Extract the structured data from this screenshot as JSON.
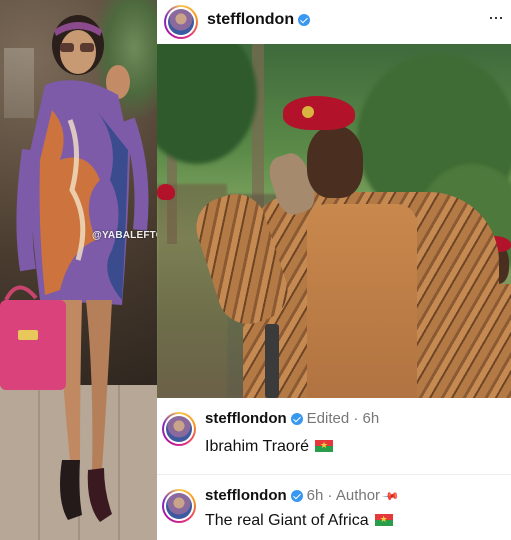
{
  "post": {
    "author": "stefflondon",
    "watermark": "@YABALEFTONLINE"
  },
  "header": {
    "username": "stefflondon",
    "more": "···"
  },
  "comments": [
    {
      "username": "stefflondon",
      "meta": "Edited · 6h",
      "text": "Ibrahim Traoré",
      "flag": "burkina-faso-flag"
    },
    {
      "username": "stefflondon",
      "meta": "6h · Author",
      "pin": "pin-icon",
      "text": "The real Giant of Africa",
      "flag": "burkina-faso-flag"
    }
  ],
  "colors": {
    "verified": "#3897f0",
    "meta_text": "#777777",
    "beret": "#b3132a"
  }
}
